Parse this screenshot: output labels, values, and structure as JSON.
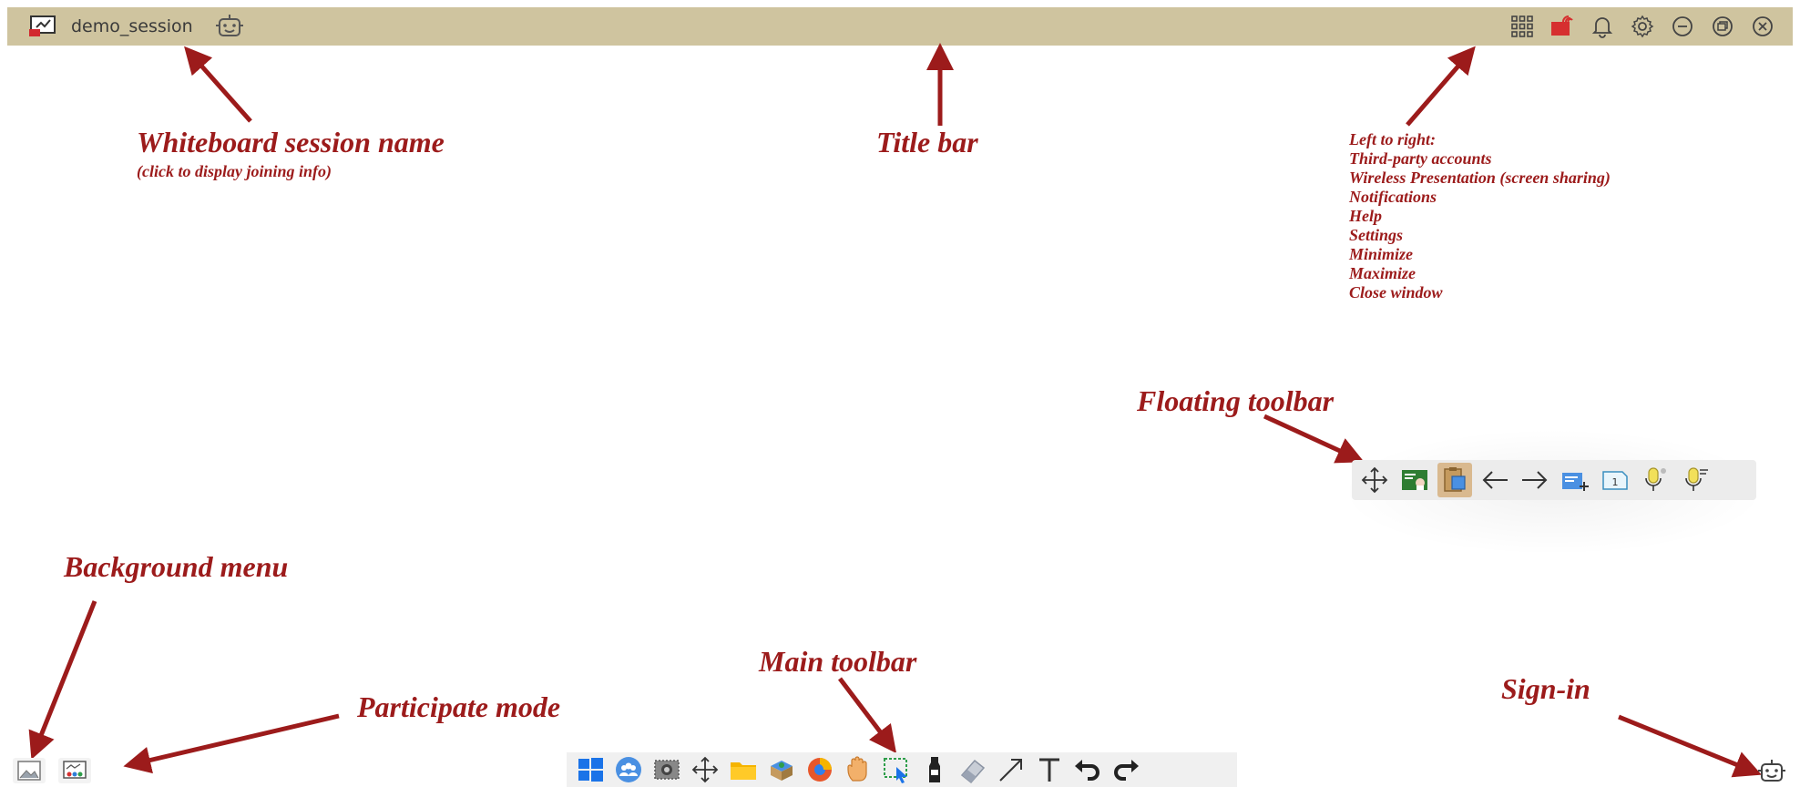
{
  "titlebar": {
    "session_name": "demo_session",
    "buttons": [
      {
        "name": "third-party-accounts-button",
        "icon": "grid-icon"
      },
      {
        "name": "wireless-presentation-button",
        "icon": "cast-icon"
      },
      {
        "name": "notifications-button",
        "icon": "bell-icon"
      },
      {
        "name": "settings-button",
        "icon": "gear-icon"
      },
      {
        "name": "minimize-button",
        "icon": "minus-circle-icon"
      },
      {
        "name": "maximize-button",
        "icon": "restore-icon"
      },
      {
        "name": "close-button",
        "icon": "close-circle-icon"
      }
    ]
  },
  "annotations": {
    "session_title": "Whiteboard session name",
    "session_sub": "(click to display joining info)",
    "title_bar": "Title bar",
    "buttons_list": [
      "Left to right:",
      "Third-party accounts",
      "Wireless Presentation (screen sharing)",
      "Notifications",
      "Help",
      "Settings",
      "Minimize",
      "Maximize",
      "Close window"
    ],
    "floating_toolbar": "Floating toolbar",
    "background_menu": "Background menu",
    "participate_mode": "Participate mode",
    "main_toolbar": "Main toolbar",
    "sign_in": "Sign-in"
  },
  "floating_toolbar": {
    "page_number": "1",
    "items": [
      "move-icon",
      "whiteboard-icon",
      "clipboard-icon",
      "arrow-left-icon",
      "arrow-right-icon",
      "add-page-icon",
      "page-number-icon",
      "microphone-icon",
      "microphone-text-icon"
    ]
  },
  "main_toolbar": {
    "items": [
      "windows-icon",
      "participants-icon",
      "screenshot-icon",
      "pan-icon",
      "folder-icon",
      "apps-icon",
      "browser-icon",
      "hand-icon",
      "select-icon",
      "pen-icon",
      "eraser-icon",
      "line-icon",
      "text-icon",
      "undo-icon",
      "redo-icon"
    ]
  },
  "colors": {
    "titlebar_bg": "#cfc49f",
    "annotation_red": "#9c1b1b"
  }
}
